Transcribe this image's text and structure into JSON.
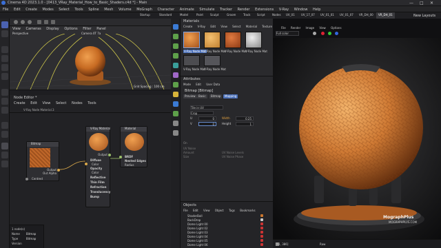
{
  "window": {
    "title": "Cinema 4D 2023.1.0 - [0413_VRay_Material_How_to_Basic_Shaders.c4d *] - Main",
    "controls": [
      "—",
      "□",
      "✕"
    ]
  },
  "menubar": [
    "File",
    "Edit",
    "Create",
    "Modes",
    "Select",
    "Tools",
    "Spline",
    "Mesh",
    "Volume",
    "MoGraph",
    "Character",
    "Animate",
    "Simulate",
    "Tracker",
    "Render",
    "Extensions",
    "V-Ray",
    "Window",
    "Help"
  ],
  "layout_tabs": [
    "Startup",
    "Standard",
    "Model",
    "Paint",
    "Sculpt",
    "Groom",
    "Track",
    "Script",
    "Nodes",
    "UV_01",
    "UV_17_07",
    "UV_01_01",
    "UV_01_07",
    "VR_DH_00",
    "VR_DH_01"
  ],
  "layout_active": "VR_DH_01",
  "new_layouts": "New Layouts",
  "viewport": {
    "menu": [
      "View",
      "Cameras",
      "Display",
      "Options",
      "Filter",
      "Panel"
    ],
    "label": "Perspective",
    "camera": "Camera 0T 7a",
    "grid": "Grid Spacing : 100 cm"
  },
  "node_editor": {
    "title": "Node Editor *",
    "menu": [
      "Create",
      "Edit",
      "View",
      "Select",
      "Nodes",
      "Tools"
    ],
    "breadcrumb": "V-Ray Node Material.3",
    "bitmap": {
      "title": "Bitmap",
      "outputs": [
        "Output",
        "Out Alpha"
      ],
      "inputs": [
        "Centred"
      ]
    },
    "vray_material": {
      "title": "V-Ray Material",
      "out": "Output",
      "inputs": [
        "Diffuse",
        "Color",
        "Opacity",
        "Color",
        "Reflective",
        "Thin Film",
        "Refraction",
        "Translucency",
        "Bump"
      ]
    },
    "material": {
      "title": "Material",
      "inputs": [
        "BRDF",
        "Nested Edges",
        "Radius"
      ]
    },
    "bottom_info": {
      "line1": "1 node(s)",
      "name_label": "Name",
      "name_value": "Bitmap",
      "type_label": "Type",
      "type_value": "Bitmap",
      "version": "Version"
    }
  },
  "materials": {
    "title": "Materials",
    "menu": [
      "Create",
      "V-Ray",
      "Edit",
      "View",
      "Select",
      "Material",
      "Texture"
    ],
    "items": [
      "V-Ray Node Mat",
      "V-Ray Node Mat",
      "V-Ray Node Mat",
      "V-Ray Node Mat",
      "V-Ray Node Mat",
      "V-Ray Node Mat"
    ],
    "colors": [
      "#c8762e",
      "#e09a3a",
      "#c35a24",
      "#bdbdbd",
      "#4c4c50",
      "#6a6a70"
    ]
  },
  "attributes": {
    "title": "Attributes",
    "menu": [
      "Mode",
      "Edit",
      "User Data"
    ],
    "object": "Bitmap [Bitmap]",
    "tabs": [
      "Preview",
      "Basic",
      "Bitmap",
      "Mapping"
    ],
    "active_tab": "Mapping",
    "rows": [
      {
        "label": "Tile in UV",
        "value": "Tile in UV"
      },
      {
        "label": "Crop",
        "value": "Crop"
      },
      {
        "label": "U",
        "value": "0",
        "label2": "Width",
        "value2": "0.25"
      },
      {
        "label": "V",
        "value": "0",
        "label2": "Height",
        "value2": "1"
      }
    ],
    "extra": [
      "On",
      "UV Noise",
      "Amount",
      "Size",
      "UV Noise Levels",
      "UV Noise Phase",
      "Levels",
      "Phase"
    ]
  },
  "objects": {
    "title": "Objects",
    "menu": [
      "File",
      "Edit",
      "View",
      "Object",
      "Tags",
      "Bookmarks"
    ],
    "items": [
      "ShaderBall",
      "BackDrop",
      "Dome Light 00",
      "Dome Light 02",
      "Dome Light 03",
      "Dome Light 04",
      "Dome Light 05",
      "Dome Light 06"
    ]
  },
  "render_view": {
    "menu": [
      "File",
      "Render",
      "Image",
      "View",
      "Options"
    ],
    "dropdown": "Full color",
    "status_value": "[51, 386]",
    "status_mode": "Raw",
    "watermark": "MographPlus",
    "watermark_url": "MOGRAPHPLUS.COM"
  }
}
